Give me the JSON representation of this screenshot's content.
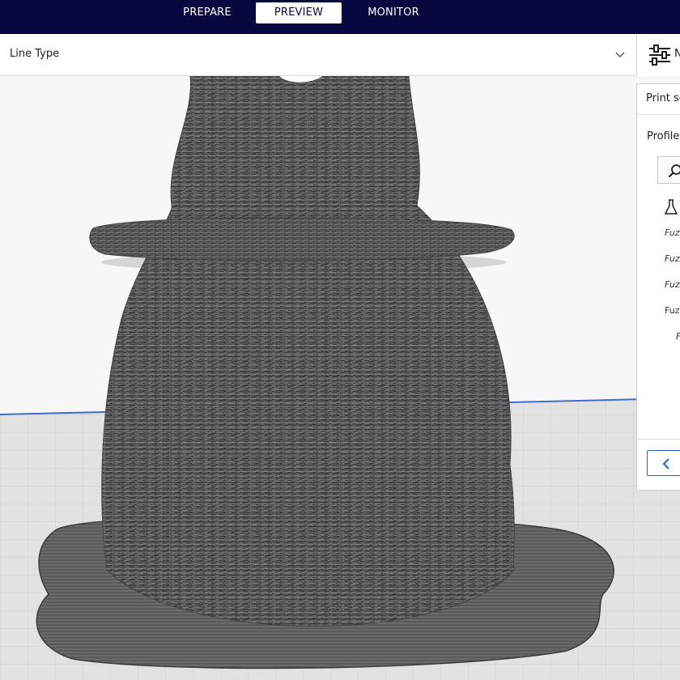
{
  "nav": {
    "tabs": [
      {
        "label": "PREPARE",
        "active": false
      },
      {
        "label": "PREVIEW",
        "active": true
      },
      {
        "label": "MONITOR",
        "active": false
      }
    ]
  },
  "view": {
    "selected": "Line Type",
    "chevron_icon": "chevron-down-icon"
  },
  "settings_tab": {
    "icon": "sliders-icon",
    "label_fragment": "N"
  },
  "panel": {
    "title": "Print se",
    "profile_label": "Profile",
    "search_icon": "search-icon",
    "experimental_icon": "flask-icon",
    "rows": [
      "Fuzz",
      "Fuzz",
      "Fuzz",
      "Fuz",
      "F"
    ],
    "back_icon": "chevron-left-icon"
  },
  "colors": {
    "nav_background": "#08073f",
    "accent_blue": "#1f63d8",
    "model_gray": "#5a5a5a",
    "build_plate": "#e2e2e2"
  }
}
